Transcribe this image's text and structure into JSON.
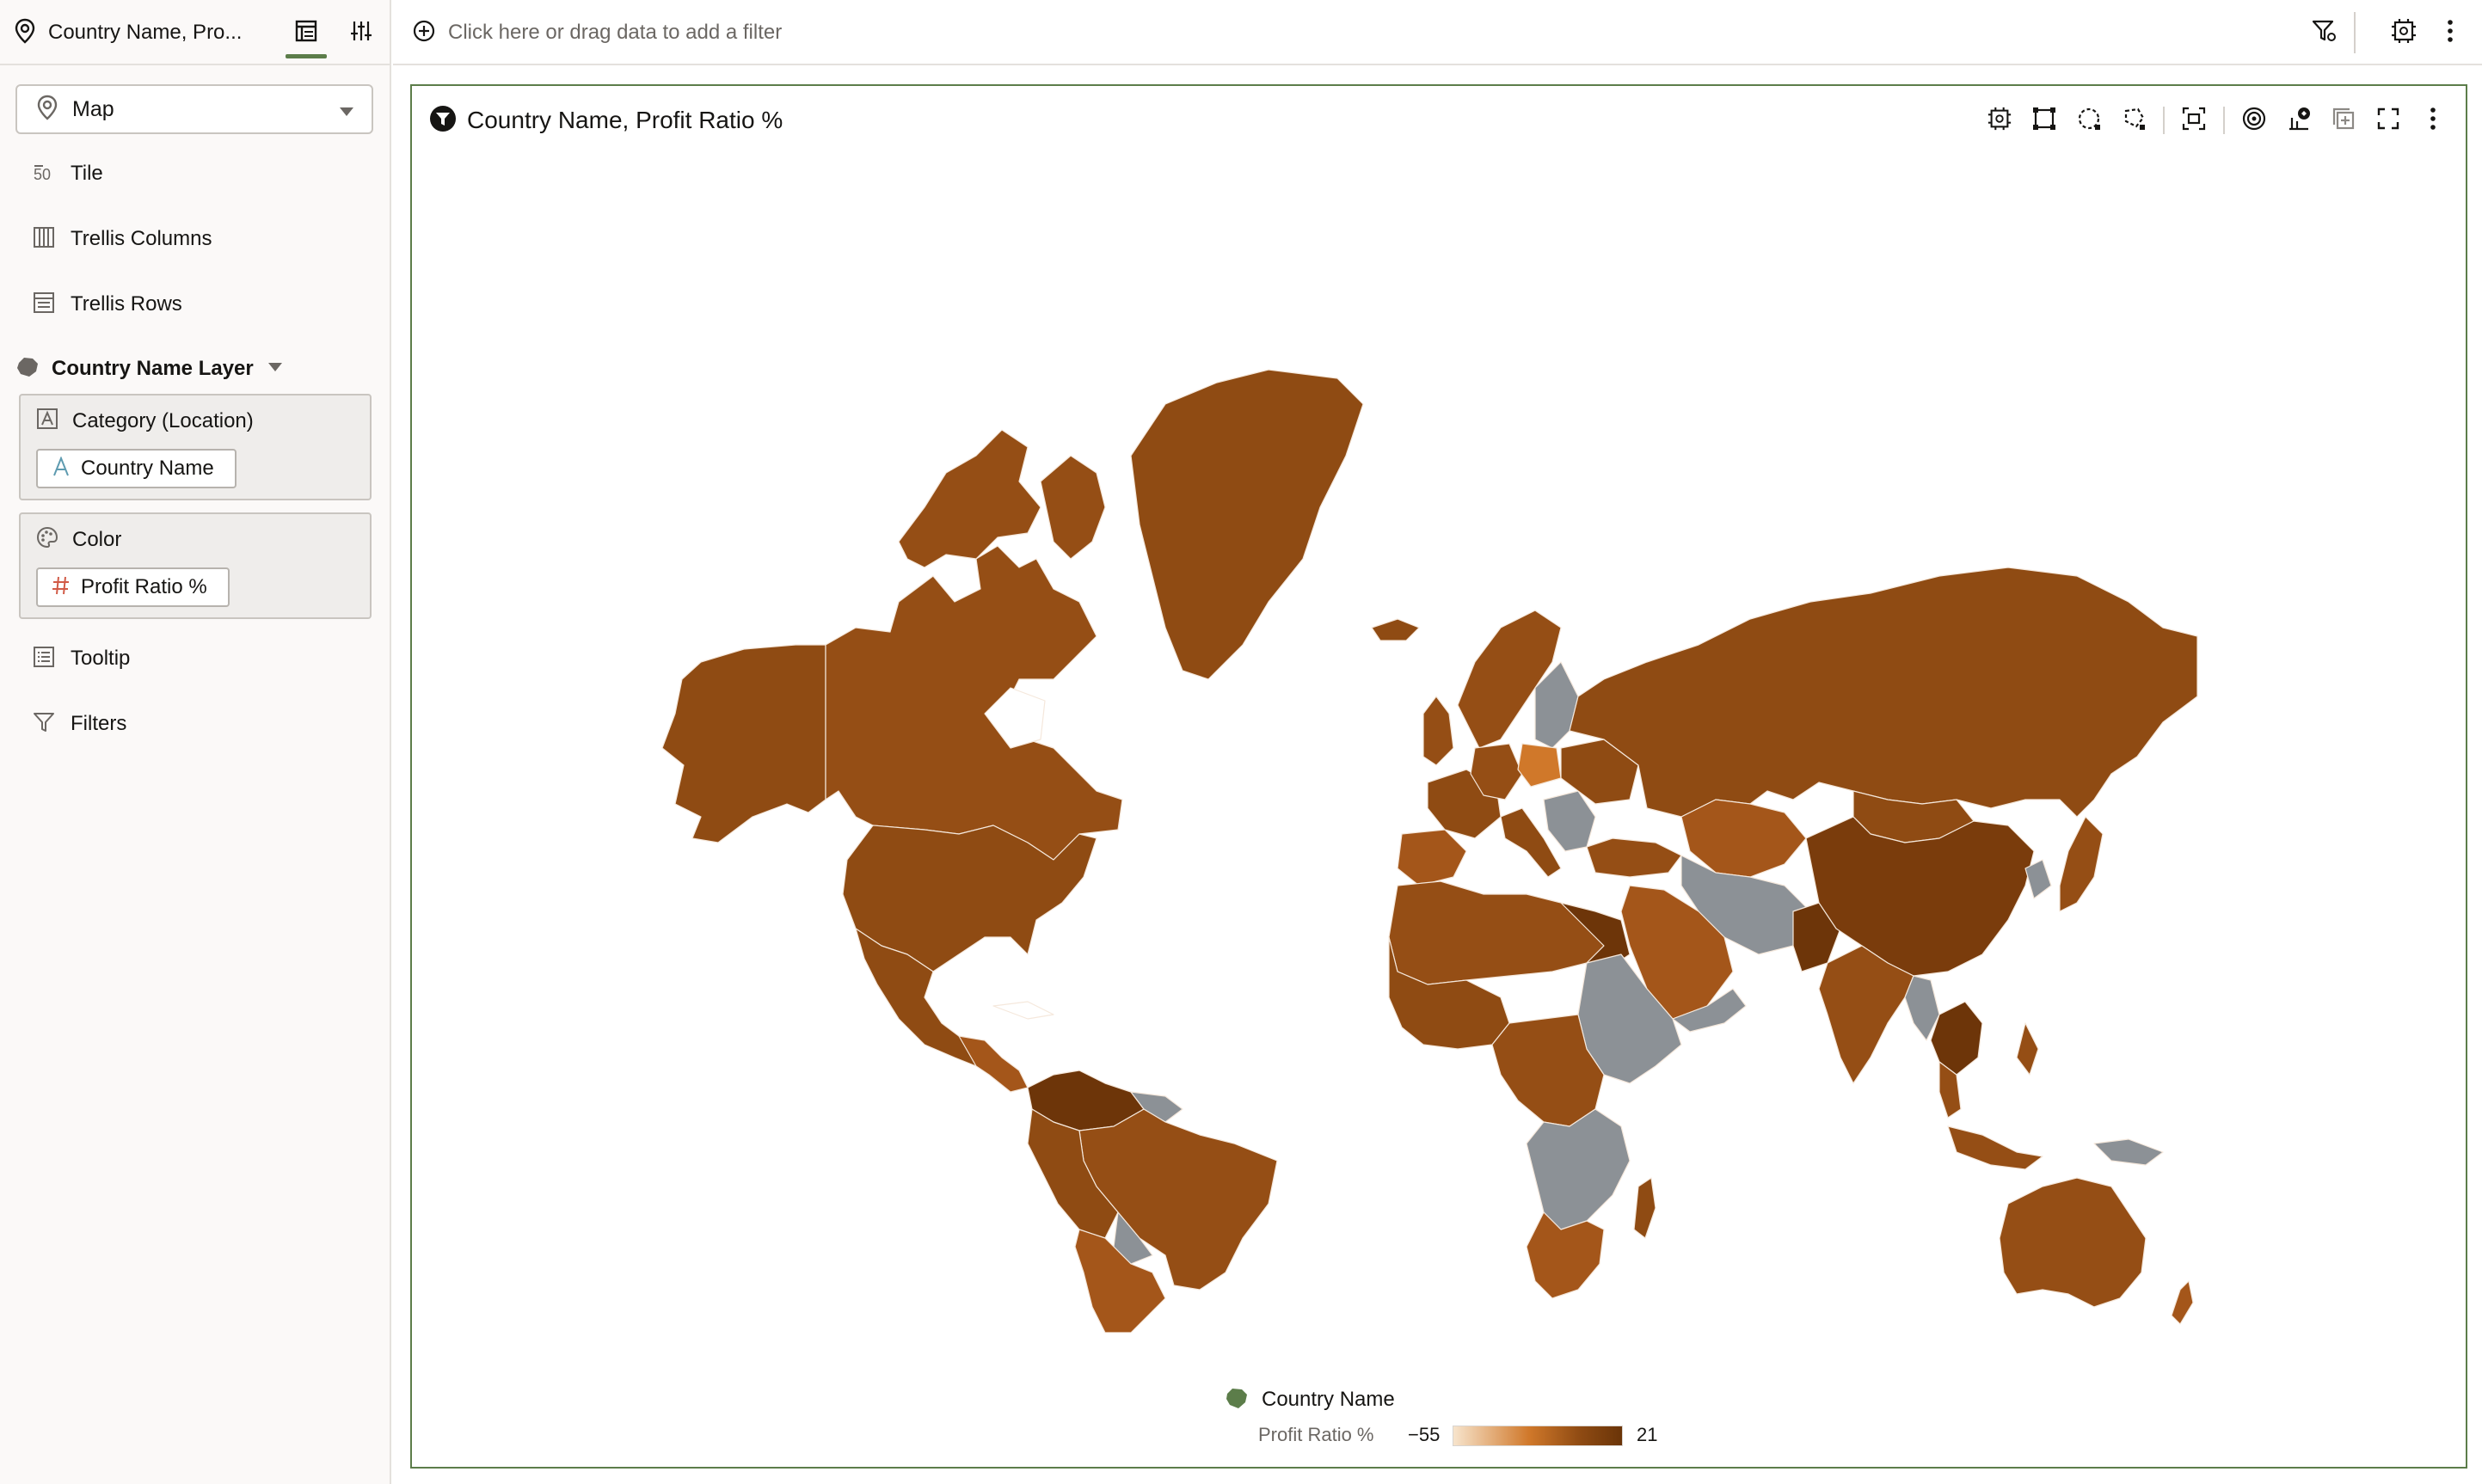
{
  "left_pane": {
    "title": "Country Name, Pro...",
    "viz_type": "Map",
    "tile_label": "Tile",
    "trellis_columns_label": "Trellis Columns",
    "trellis_rows_label": "Trellis Rows",
    "layer_name": "Country Name Layer",
    "category_box": {
      "title": "Category (Location)",
      "field": "Country Name"
    },
    "color_box": {
      "title": "Color",
      "field": "Profit Ratio %"
    },
    "tooltip_label": "Tooltip",
    "filters_label": "Filters"
  },
  "filter_bar": {
    "placeholder": "Click here or drag data to add a filter"
  },
  "viz": {
    "title": "Country Name, Profit Ratio %",
    "legend": {
      "layer_label": "Country Name",
      "measure_label": "Profit Ratio %",
      "min": "−55",
      "max": "21"
    }
  },
  "colors": {
    "accent": "#5c7d4a",
    "map_main": "#8f4b13",
    "map_mid": "#a4561a",
    "map_dark": "#6d3509",
    "map_light": "#d0782a",
    "no_data": "#8c9196",
    "legend_low": "#f7e4cc",
    "legend_high": "#6a3408"
  }
}
